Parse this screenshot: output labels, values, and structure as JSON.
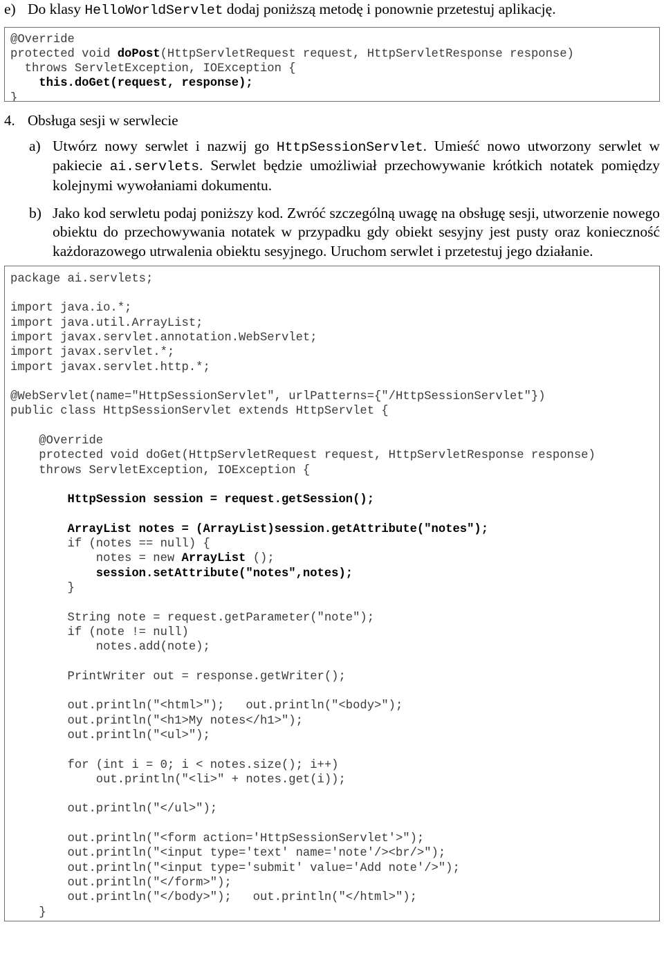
{
  "document": {
    "language": "pl",
    "border_color": "#6e6e6e",
    "code_text_color": "#3a3a3a"
  },
  "task_e": {
    "marker": "e)",
    "text_part1": "Do klasy ",
    "class_name": "HelloWorldServlet",
    "text_part2": " dodaj poniższą metodę i ponownie przetestuj aplikację."
  },
  "code_dopost": {
    "lines": [
      [
        {
          "t": "@Override",
          "b": false
        }
      ],
      [
        {
          "t": "protected void ",
          "b": false
        },
        {
          "t": "doPost",
          "b": true
        },
        {
          "t": "(HttpServletRequest request, HttpServletResponse response)",
          "b": false
        }
      ],
      [
        {
          "t": "  throws ServletException, IOException {",
          "b": false
        }
      ],
      [
        {
          "t": "    ",
          "b": false
        },
        {
          "t": "this.doGet(request, response);",
          "b": true
        }
      ],
      [
        {
          "t": "}",
          "b": false
        }
      ]
    ]
  },
  "section_4": {
    "marker": "4.",
    "title": "Obsługa sesji w serwlecie"
  },
  "task_a": {
    "marker": "a)",
    "text_part1": "Utwórz nowy serwlet i nazwij go ",
    "servlet_name": "HttpSessionServlet",
    "text_part2": ". Umieść nowo utworzony serwlet w pakiecie ",
    "package_name": "ai.servlets",
    "text_part3": ". Serwlet będzie umożliwiał przechowywanie krótkich notatek pomiędzy kolejnymi wywołaniami dokumentu."
  },
  "task_b": {
    "marker": "b)",
    "text": "Jako kod serwletu podaj poniższy kod. Zwróć szczególną uwagę na obsługę sesji, utworzenie nowego obiektu do przechowywania notatek w przypadku gdy obiekt sesyjny jest pusty oraz konieczność każdorazowego utrwalenia obiektu sesyjnego. Uruchom serwlet i przetestuj jego działanie."
  },
  "code_session": {
    "lines": [
      [
        {
          "t": "package ai.servlets;",
          "b": false
        }
      ],
      [
        {
          "t": "",
          "b": false
        }
      ],
      [
        {
          "t": "import java.io.*;",
          "b": false
        }
      ],
      [
        {
          "t": "import java.util.ArrayList;",
          "b": false
        }
      ],
      [
        {
          "t": "import javax.servlet.annotation.WebServlet;",
          "b": false
        }
      ],
      [
        {
          "t": "import javax.servlet.*;",
          "b": false
        }
      ],
      [
        {
          "t": "import javax.servlet.http.*;",
          "b": false
        }
      ],
      [
        {
          "t": "",
          "b": false
        }
      ],
      [
        {
          "t": "@WebServlet(name=\"HttpSessionServlet\", urlPatterns={\"/HttpSessionServlet\"})",
          "b": false
        }
      ],
      [
        {
          "t": "public class HttpSessionServlet extends HttpServlet {",
          "b": false
        }
      ],
      [
        {
          "t": "",
          "b": false
        }
      ],
      [
        {
          "t": "    @Override",
          "b": false
        }
      ],
      [
        {
          "t": "    protected void doGet(HttpServletRequest request, HttpServletResponse response)",
          "b": false
        }
      ],
      [
        {
          "t": "    throws ServletException, IOException {",
          "b": false
        }
      ],
      [
        {
          "t": "",
          "b": false
        }
      ],
      [
        {
          "t": "        ",
          "b": false
        },
        {
          "t": "HttpSession session = request.getSession();",
          "b": true
        }
      ],
      [
        {
          "t": "",
          "b": false
        }
      ],
      [
        {
          "t": "        ",
          "b": false
        },
        {
          "t": "ArrayList notes = (ArrayList)session.getAttribute(\"notes\");",
          "b": true
        }
      ],
      [
        {
          "t": "        if (notes == null) {",
          "b": false
        }
      ],
      [
        {
          "t": "            notes = new ",
          "b": false
        },
        {
          "t": "ArrayList",
          "b": true
        },
        {
          "t": " ();",
          "b": false
        }
      ],
      [
        {
          "t": "            ",
          "b": false
        },
        {
          "t": "session.setAttribute(\"notes\",notes);",
          "b": true
        }
      ],
      [
        {
          "t": "        }",
          "b": false
        }
      ],
      [
        {
          "t": "",
          "b": false
        }
      ],
      [
        {
          "t": "        String note = request.getParameter(\"note\");",
          "b": false
        }
      ],
      [
        {
          "t": "        if (note != null)",
          "b": false
        }
      ],
      [
        {
          "t": "            notes.add(note);",
          "b": false
        }
      ],
      [
        {
          "t": "",
          "b": false
        }
      ],
      [
        {
          "t": "        PrintWriter out = response.getWriter();",
          "b": false
        }
      ],
      [
        {
          "t": "",
          "b": false
        }
      ],
      [
        {
          "t": "        out.println(\"<html>\");   out.println(\"<body>\");",
          "b": false
        }
      ],
      [
        {
          "t": "        out.println(\"<h1>My notes</h1>\");",
          "b": false
        }
      ],
      [
        {
          "t": "        out.println(\"<ul>\");",
          "b": false
        }
      ],
      [
        {
          "t": "",
          "b": false
        }
      ],
      [
        {
          "t": "        for (int i = 0; i < notes.size(); i++)",
          "b": false
        }
      ],
      [
        {
          "t": "            out.println(\"<li>\" + notes.get(i));",
          "b": false
        }
      ],
      [
        {
          "t": "",
          "b": false
        }
      ],
      [
        {
          "t": "        out.println(\"</ul>\");",
          "b": false
        }
      ],
      [
        {
          "t": "",
          "b": false
        }
      ],
      [
        {
          "t": "        out.println(\"<form action='HttpSessionServlet'>\");",
          "b": false
        }
      ],
      [
        {
          "t": "        out.println(\"<input type='text' name='note'/><br/>\");",
          "b": false
        }
      ],
      [
        {
          "t": "        out.println(\"<input type='submit' value='Add note'/>\");",
          "b": false
        }
      ],
      [
        {
          "t": "        out.println(\"</form>\");",
          "b": false
        }
      ],
      [
        {
          "t": "        out.println(\"</body>\");   out.println(\"</html>\");",
          "b": false
        }
      ],
      [
        {
          "t": "    }",
          "b": false
        }
      ],
      [
        {
          "t": "}",
          "b": false
        }
      ]
    ]
  }
}
